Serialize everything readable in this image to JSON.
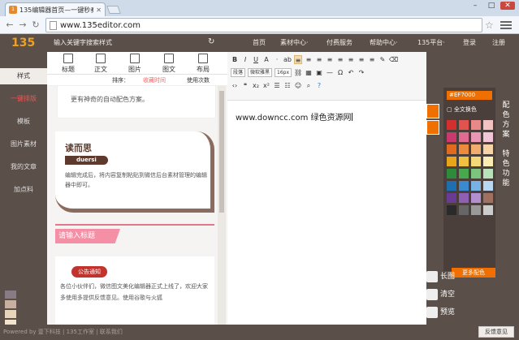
{
  "browser": {
    "tab_title": "135编辑器首页—一键秒奏",
    "url": "www.135editor.com"
  },
  "app": {
    "logo_text": "135",
    "search_placeholder": "输入关键字搜索样式",
    "nav": [
      "首页",
      "素材中心·",
      "付费服务",
      "帮助中心·",
      "135平台·",
      "登录",
      "注册"
    ],
    "left_nav": [
      "样式",
      "一键排版",
      "模板",
      "图片素材",
      "我的文章",
      "加点料"
    ],
    "tool_tabs": [
      "标题",
      "正文",
      "图片",
      "图文",
      "布局"
    ],
    "sort_label": "排序：",
    "sort_fav": "收藏时间",
    "sort_use": "使用次数",
    "card1_text": "更有神奇的自动配色方案。",
    "card2_title": "读而思",
    "card2_pill": "duersi",
    "card2_text": "编辑完成后，将内容复制粘贴到微信后台素材管理的编辑器中即可。",
    "pink_title": "请输入标题",
    "card3_tag": "公告通知",
    "card3_text": "各位小伙伴们，微信图文美化编辑器正式上线了，欢迎大家多使用多提供反馈意见。使用谷歌与火狐"
  },
  "editor": {
    "row1": [
      "B",
      "I",
      "U",
      "A",
      "·",
      "ab",
      "≡",
      "≡",
      "≡",
      "≡",
      "≡",
      "≡",
      "≡",
      "≡"
    ],
    "font_size_sel": "段落",
    "font_family_sel": "微软雅黑",
    "size_sel": "16px",
    "content": "www.downcc.com   绿色资源网"
  },
  "right": {
    "hex": "#EF7000",
    "all_label": "全文换色",
    "more": "更多配色",
    "vtab1": "配色方案",
    "vtab2": "特色功能",
    "long_img": "长图",
    "clear": "清空",
    "preview": "预览",
    "palette": [
      "#d2302f",
      "#e0534e",
      "#e88888",
      "#f3c2c2",
      "#c83a6e",
      "#df6a92",
      "#ea97b5",
      "#f2c6d8",
      "#e06a1e",
      "#ec8a3e",
      "#f1ad6e",
      "#f7d4a8",
      "#e8a51a",
      "#f0c040",
      "#f5d878",
      "#faecb2",
      "#2e8b3a",
      "#48a84e",
      "#7cc47e",
      "#b8e0ba",
      "#1e6fb0",
      "#3b8ad0",
      "#78b2e4",
      "#b8d8f2",
      "#6a3b92",
      "#8e5fb2",
      "#b48fd0",
      "#a07060",
      "#2a2a2a",
      "#666666",
      "#999999",
      "#cccccc"
    ],
    "left_swatches": [
      "#8a7a86",
      "#c8b0a0",
      "#e8d4b8",
      "#f2e4cc"
    ]
  },
  "footer": {
    "copyright": "Powered by 壹下科技 | 135工作室 | 联系我们",
    "feedback": "反馈意见"
  }
}
